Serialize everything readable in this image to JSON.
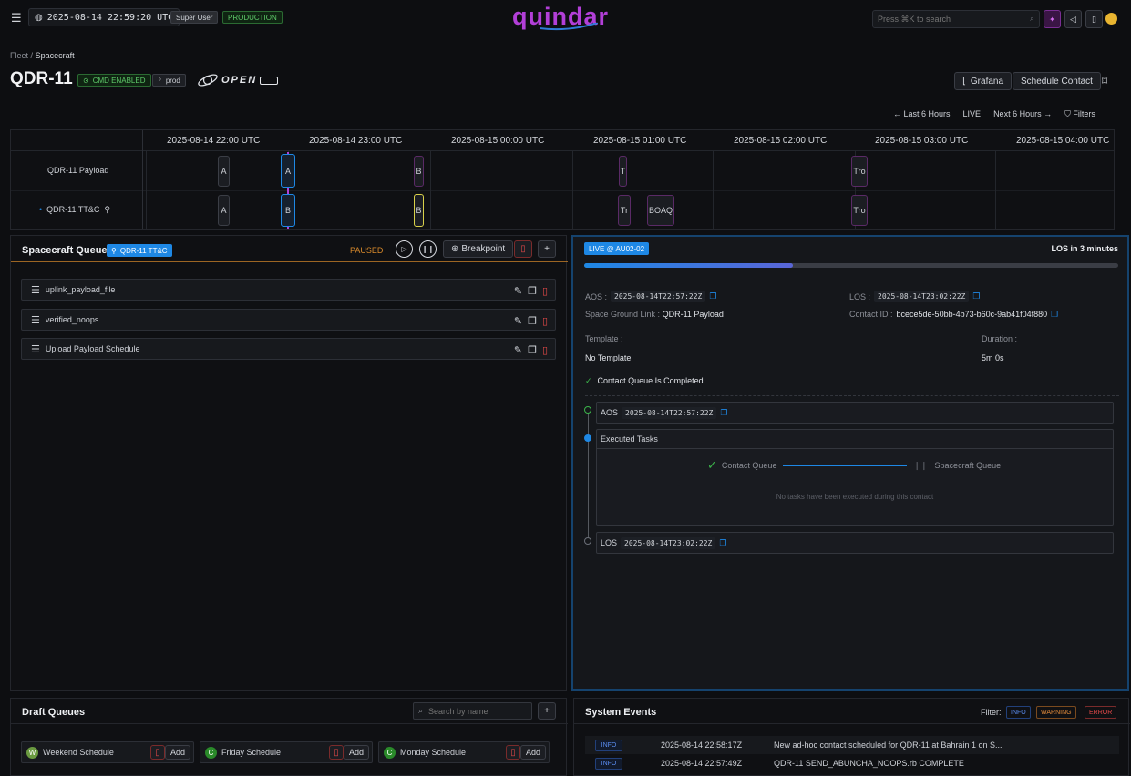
{
  "topbar": {
    "clock": "2025-08-14 22:59:20 UTC",
    "role_badge": "Super User",
    "env_badge": "PRODUCTION",
    "logo": "quindar",
    "search_placeholder": "Press ⌘K to search"
  },
  "breadcrumb": {
    "root": "Fleet",
    "sep": "/",
    "current": "Spacecraft"
  },
  "header": {
    "title": "QDR-11",
    "cmd_badge": "CMD ENABLED",
    "env_tag": "prod",
    "partner_logo": "OPEN",
    "grafana_label": "Grafana",
    "schedule_label": "Schedule Contact"
  },
  "timeline_controls": {
    "last": "Last 6 Hours",
    "live": "LIVE",
    "next": "Next 6 Hours",
    "filters": "Filters"
  },
  "timeline": {
    "hours": [
      "2025-08-14 22:00 UTC",
      "2025-08-14 23:00 UTC",
      "2025-08-15 00:00 UTC",
      "2025-08-15 01:00 UTC",
      "2025-08-15 02:00 UTC",
      "2025-08-15 03:00 UTC",
      "2025-08-15 04:00 UTC"
    ],
    "rows": [
      {
        "label": "QDR-11 Payload",
        "events": [
          "A",
          "A",
          "B",
          "T",
          "Tro"
        ]
      },
      {
        "label": "QDR-11 TT&C",
        "events": [
          "A",
          "B",
          "B",
          "Tr",
          "BOAQ",
          "Tro"
        ]
      }
    ]
  },
  "queue": {
    "title": "Spacecraft Queue",
    "badge": "QDR-11 TT&C",
    "status": "PAUSED",
    "breakpoint_label": "Breakpoint",
    "items": [
      "uplink_payload_file",
      "verified_noops",
      "Upload Payload Schedule"
    ]
  },
  "contact": {
    "live_badge": "LIVE @ AU02-02",
    "los_countdown": "LOS in 3 minutes",
    "progress": 0.39,
    "aos_label": "AOS :",
    "aos_value": "2025-08-14T22:57:22Z",
    "los_label": "LOS :",
    "los_value": "2025-08-14T23:02:22Z",
    "link_label": "Space Ground Link :",
    "link_value": "QDR-11 Payload",
    "contact_id_label": "Contact ID :",
    "contact_id_value": "bcece5de-50bb-4b73-b60c-9ab41f04f880",
    "template_label": "Template :",
    "template_value": "No Template",
    "duration_label": "Duration :",
    "duration_value": "5m 0s",
    "queue_completed": "Contact Queue Is Completed",
    "step_aos_label": "AOS",
    "step_aos_value": "2025-08-14T22:57:22Z",
    "executed_title": "Executed Tasks",
    "contact_queue_label": "Contact Queue",
    "spacecraft_queue_label": "Spacecraft Queue",
    "no_tasks": "No tasks have been executed during this contact",
    "step_los_label": "LOS",
    "step_los_value": "2025-08-14T23:02:22Z"
  },
  "drafts": {
    "title": "Draft Queues",
    "search_placeholder": "Search by name",
    "add_label": "Add",
    "items": [
      {
        "name": "Weekend Schedule",
        "icon": "W"
      },
      {
        "name": "Friday Schedule",
        "icon": "C"
      },
      {
        "name": "Monday Schedule",
        "icon": "C"
      }
    ]
  },
  "events": {
    "title": "System Events",
    "filter_label": "Filter:",
    "filters": [
      "INFO",
      "WARNING",
      "ERROR"
    ],
    "rows": [
      {
        "level": "INFO",
        "time": "2025-08-14 22:58:17Z",
        "message": "New ad-hoc contact scheduled for QDR-11 at Bahrain 1 on S..."
      },
      {
        "level": "INFO",
        "time": "2025-08-14 22:57:49Z",
        "message": "QDR-11 SEND_ABUNCHA_NOOPS.rb COMPLETE"
      }
    ]
  },
  "colors": {
    "accent_blue": "#1e88e5",
    "cmd_green": "#3bb34a",
    "paused_orange": "#d98a2b",
    "logo_purple": "#b23fd8",
    "danger_red": "#e04848"
  }
}
